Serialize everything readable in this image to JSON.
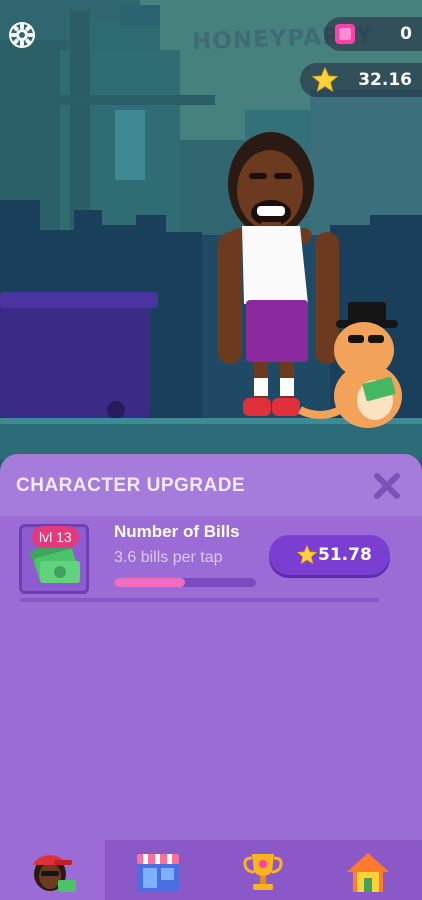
{
  "top_bar": {
    "settings_icon": "gear-icon",
    "gems": "0",
    "gem_icon": "pink-gem-icon",
    "stars": "32.16",
    "star_icon": "star-icon"
  },
  "scene": {
    "sign_text": "HONEYPARTY"
  },
  "panel": {
    "title": "CHARACTER UPGRADE",
    "close_icon": "close-icon",
    "upgrades": [
      {
        "level": "lvl 13",
        "name": "Number of Bills",
        "description": "3.6 bills per tap",
        "progress": 0.5,
        "price": "51.78",
        "icon": "cash-bills-icon"
      }
    ]
  },
  "tabs": [
    {
      "name": "character",
      "icon": "character-icon",
      "active": true
    },
    {
      "name": "shop",
      "icon": "shop-icon",
      "active": false
    },
    {
      "name": "achievements",
      "icon": "trophy-icon",
      "active": false
    },
    {
      "name": "home",
      "icon": "home-icon",
      "active": false
    }
  ],
  "colors": {
    "panel": "#9b6bd6",
    "accent_button": "#7a3fd0",
    "badge": "#e6397b",
    "progress": "#ef6fbd",
    "star": "#ffd23a",
    "gem": "#ff3fa8"
  }
}
